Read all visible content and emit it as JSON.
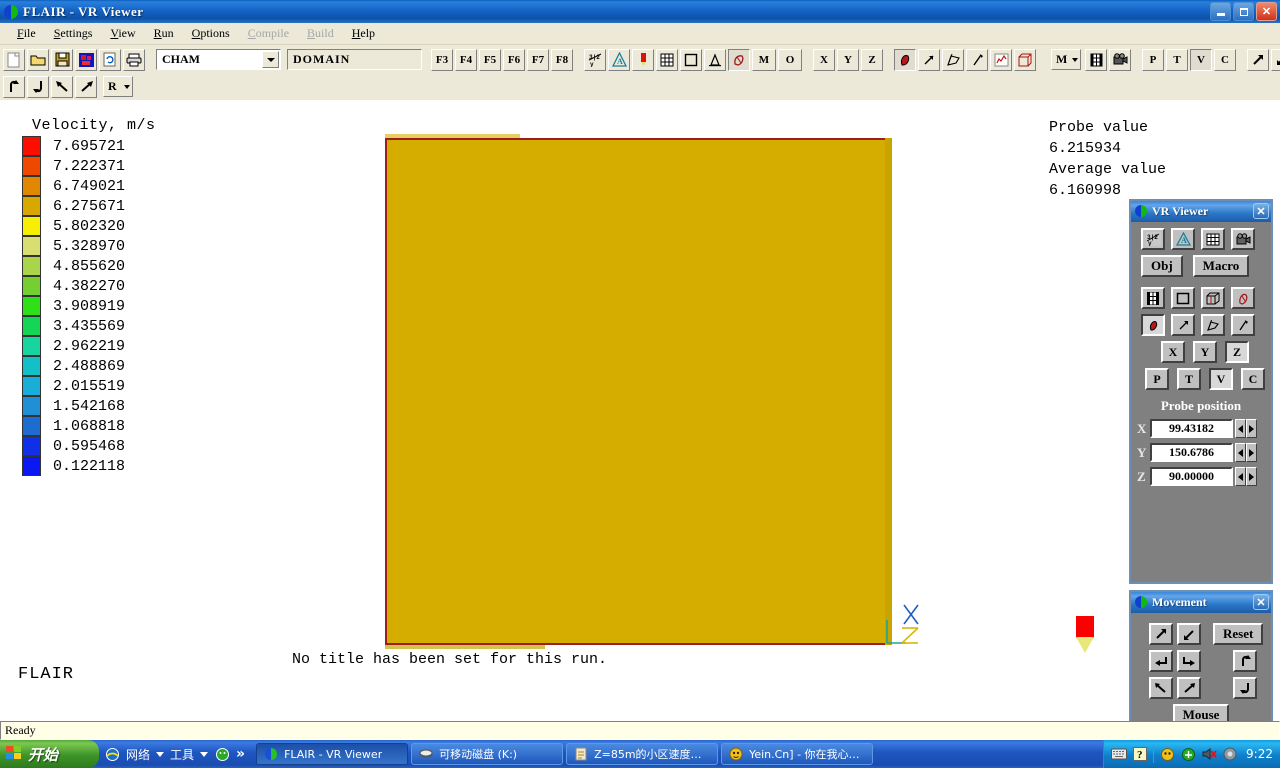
{
  "window": {
    "title": "FLAIR - VR Viewer",
    "icon": "flair-logo-icon",
    "minimize_label": "Minimize",
    "maximize_label": "Maximize",
    "close_label": "✕"
  },
  "menu": {
    "items": [
      {
        "label": "File",
        "disabled": false
      },
      {
        "label": "Settings",
        "disabled": false
      },
      {
        "label": "View",
        "disabled": false
      },
      {
        "label": "Run",
        "disabled": false
      },
      {
        "label": "Options",
        "disabled": false
      },
      {
        "label": "Compile",
        "disabled": true
      },
      {
        "label": "Build",
        "disabled": true
      },
      {
        "label": "Help",
        "disabled": false
      }
    ]
  },
  "toolbar": {
    "row1_file_icons": [
      "new-file-icon",
      "open-folder-icon",
      "save-disk-icon",
      "palette-icon",
      "refresh-icon",
      "print-icon"
    ],
    "case_combo_value": "CHAM",
    "domain_field_value": "DOMAIN",
    "function_keys": [
      "F3",
      "F4",
      "F5",
      "F6",
      "F7",
      "F8"
    ],
    "view_buttons": [
      "vector-icon",
      "contour-icon",
      "probe-icon",
      "grid-icon",
      "outline-icon",
      "surface-icon",
      "iso-icon"
    ],
    "mo_buttons": [
      "M",
      "O"
    ],
    "axis_buttons": [
      "X",
      "Y",
      "Z"
    ],
    "vel_buttons": [
      "streamline-icon",
      "arrow-icon",
      "flag-icon",
      "pen-icon",
      "chart-icon",
      "box-icon"
    ],
    "m_dropdown": "M",
    "film_buttons": [
      "film-icon",
      "camera-icon"
    ],
    "ptvc_buttons": [
      "P",
      "T",
      "V",
      "C"
    ],
    "nav_arrows": [
      "arrow-up-right-icon",
      "arrow-down-left-icon",
      "arrow-return-left-icon",
      "arrow-return-right-icon"
    ],
    "row2_rotate_icons": [
      "rotate-up-icon",
      "rotate-down-icon",
      "rotate-left-icon",
      "rotate-right-icon"
    ],
    "r_combo_value": "R"
  },
  "chart_data": {
    "type": "heatmap",
    "title": "Velocity, m/s",
    "run_title": "No title has been set for this run.",
    "watermark": "FLAIR",
    "legend_position": "left",
    "colorbar": {
      "label": "Velocity, m/s",
      "values": [
        "7.695721",
        "7.222371",
        "6.749021",
        "6.275671",
        "5.802320",
        "5.328970",
        "4.855620",
        "4.382270",
        "3.908919",
        "3.435569",
        "2.962219",
        "2.488869",
        "2.015519",
        "1.542168",
        "1.068818",
        "0.595468",
        "0.122118"
      ],
      "colors": [
        "#fc0d00",
        "#ef4800",
        "#e08800",
        "#d9a800",
        "#f6f000",
        "#d9de70",
        "#aad44a",
        "#74d030",
        "#2ee018",
        "#16d455",
        "#18d4a0",
        "#14c0c8",
        "#19aed8",
        "#2090d6",
        "#1e6cd0",
        "#1030e8",
        "#0a18f4"
      ],
      "min": 0.122118,
      "max": 7.695721
    },
    "plot_fill_color": "#d4ad00",
    "plot_border_color": "#9e1d1d",
    "axes_triad": [
      "X",
      "Y",
      "Z"
    ]
  },
  "probe_readout": {
    "probe_value_label": "Probe value",
    "probe_value": "6.215934",
    "average_value_label": "Average value",
    "average_value": "6.160998"
  },
  "vr_viewer_panel": {
    "title": "VR Viewer",
    "close_label": "✕",
    "row1": [
      "settings-icon",
      "geometry-icon",
      "grid-icon",
      "camera-icon"
    ],
    "obj_label": "Obj",
    "macro_label": "Macro",
    "row2": [
      "film-icon",
      "outline-icon",
      "box-icon",
      "shape-icon"
    ],
    "row3": [
      "streamline-icon",
      "arrow-icon",
      "flag-icon",
      "pen-icon"
    ],
    "axis_buttons": [
      "X",
      "Y",
      "Z"
    ],
    "ptvc_buttons": [
      "P",
      "T",
      "V",
      "C"
    ],
    "probe_position_label": "Probe position",
    "fields": [
      {
        "axis": "X",
        "value": "99.43182"
      },
      {
        "axis": "Y",
        "value": "150.6786"
      },
      {
        "axis": "Z",
        "value": "90.00000"
      }
    ]
  },
  "movement_panel": {
    "title": "Movement",
    "close_label": "✕",
    "reset_label": "Reset",
    "mouse_label": "Mouse",
    "buttons": [
      "move-up-right-icon",
      "move-down-left-icon",
      "move-return-left-icon",
      "move-return-right-icon",
      "move-down-left-diag-icon",
      "move-up-right-diag-icon",
      "rotate-up-icon",
      "rotate-down-icon"
    ]
  },
  "statusbar": {
    "text": "Ready"
  },
  "taskbar": {
    "start_label": "开始",
    "quicklaunch": [
      {
        "label": "网络",
        "icon": "ie-icon",
        "has_arrow": true
      },
      {
        "label": "工具",
        "icon": "tools-icon",
        "has_arrow": true
      },
      {
        "label": "",
        "icon": "msn-icon",
        "has_arrow": false
      }
    ],
    "chevron": "»",
    "tasks": [
      {
        "label": "FLAIR - VR Viewer",
        "icon": "flair-logo-icon",
        "active": true
      },
      {
        "label": "可移动磁盘 (K:)",
        "icon": "drive-icon",
        "active": false
      },
      {
        "label": "Z=85m的小区速度…",
        "icon": "doc-icon",
        "active": false
      },
      {
        "label": "Yein.Cn] - 你在我心…",
        "icon": "msn-icon",
        "active": false
      }
    ],
    "tray_icons": [
      "keyboard-icon",
      "help-icon",
      "msn-icon",
      "network-icon",
      "volume-mute-icon",
      "shield-icon"
    ],
    "clock": "9:22"
  }
}
